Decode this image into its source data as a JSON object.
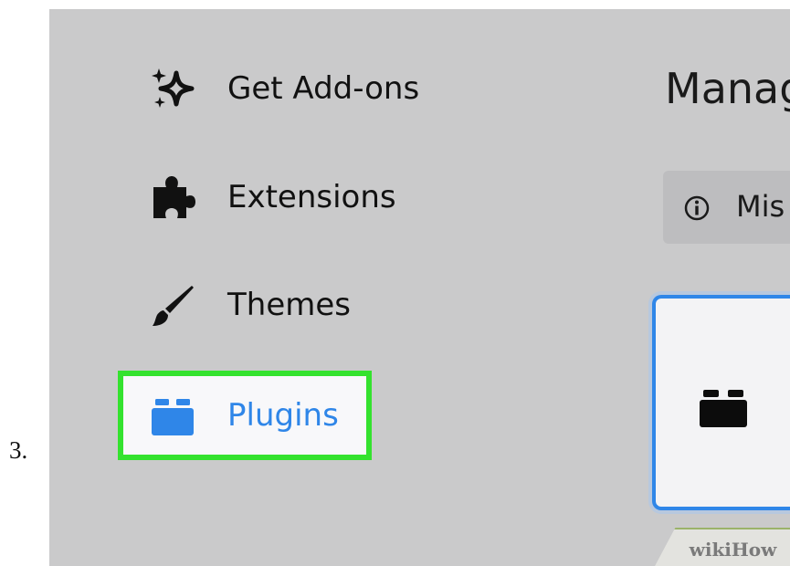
{
  "step_number": "3.",
  "sidebar": {
    "items": [
      {
        "label": "Get Add-ons",
        "icon": "sparkle-icon"
      },
      {
        "label": "Extensions",
        "icon": "puzzle-piece-icon"
      },
      {
        "label": "Themes",
        "icon": "paintbrush-icon"
      },
      {
        "label": "Plugins",
        "icon": "plugin-brick-icon",
        "selected": true
      }
    ]
  },
  "main": {
    "heading": "Manag",
    "notice": {
      "text": "Mis",
      "icon": "info-icon"
    },
    "card": {
      "icon": "plugin-brick-icon"
    }
  },
  "watermark": {
    "text": "wikiHow"
  },
  "colors": {
    "panel_background": "#cacacb",
    "selected_text": "#2f86e8",
    "highlight_border": "#34e22e",
    "card_border": "#2f86e8"
  }
}
